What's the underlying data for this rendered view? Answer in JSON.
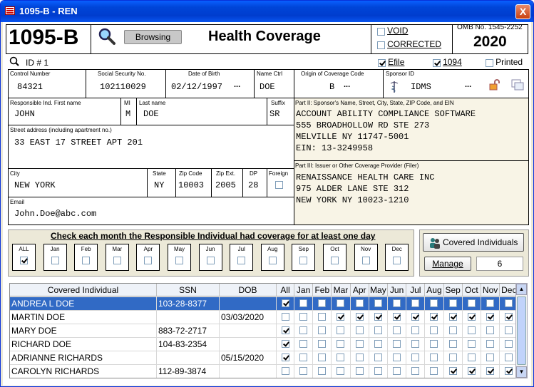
{
  "window": {
    "title": "1095-B - REN",
    "close_glyph": "X"
  },
  "header": {
    "form": "1095-B",
    "status_button": "Browsing",
    "title": "Health Coverage",
    "void_label": "VOID",
    "corrected_label": "CORRECTED",
    "void": false,
    "corrected": false,
    "omb": "OMB No. 1545-2252",
    "year": "2020"
  },
  "idrow": {
    "id_label": "ID # 1",
    "efile_label": "Efile",
    "efile": true,
    "f1094_label": "1094",
    "f1094": true,
    "printed_label": "Printed",
    "printed": false
  },
  "fields": {
    "control_number": {
      "label": "Control Number",
      "value": "84321"
    },
    "ssn": {
      "label": "Social Security No.",
      "value": "102110029"
    },
    "dob": {
      "label": "Date of Birth",
      "value": "02/12/1997"
    },
    "name_ctrl": {
      "label": "Name Ctrl",
      "value": "DOE"
    },
    "origin": {
      "label": "Origin of Coverage Code",
      "value": "B"
    },
    "sponsor": {
      "label": "Sponsor ID",
      "value": "IDMS"
    },
    "first_name": {
      "label": "Responsible Ind. First name",
      "value": "JOHN"
    },
    "mi": {
      "label": "MI",
      "value": "M"
    },
    "last_name": {
      "label": "Last name",
      "value": "DOE"
    },
    "suffix": {
      "label": "Suffix",
      "value": "SR"
    },
    "street": {
      "label": "Street address (including apartment no.)",
      "value": "33 EAST 17 STREET APT 201"
    },
    "city": {
      "label": "City",
      "value": "NEW YORK"
    },
    "state": {
      "label": "State",
      "value": "NY"
    },
    "zip": {
      "label": "Zip Code",
      "value": "10003"
    },
    "zipext": {
      "label": "Zip Ext.",
      "value": "2005"
    },
    "dp": {
      "label": "DP",
      "value": "28"
    },
    "foreign": {
      "label": "Foreign"
    },
    "email": {
      "label": "Email",
      "value": "John.Doe@abc.com"
    },
    "ellipsis": "..."
  },
  "part2": {
    "label": "Part II: Sponsor's Name, Street, City, State, ZIP Code, and EIN",
    "lines": [
      "ACCOUNT ABILITY COMPLIANCE SOFTWARE",
      "555 BROADHOLLOW RD STE 273",
      "MELVILLE NY 11747-5001",
      "EIN: 13-3249958"
    ]
  },
  "part3": {
    "label": "Part III: Issuer or Other Coverage Provider (Filer)",
    "lines": [
      "RENAISSANCE HEALTH CARE INC",
      "975 ALDER LANE STE 312",
      "NEW YORK NY 10023-1210"
    ]
  },
  "months_box": {
    "title": "Check each month the Responsible Individual had coverage for at least one day",
    "labels": [
      "ALL",
      "Jan",
      "Feb",
      "Mar",
      "Apr",
      "May",
      "Jun",
      "Jul",
      "Aug",
      "Sep",
      "Oct",
      "Nov",
      "Dec"
    ],
    "checked": [
      true,
      false,
      false,
      false,
      false,
      false,
      false,
      false,
      false,
      false,
      false,
      false,
      false
    ]
  },
  "covered": {
    "button": "Covered Individuals",
    "manage": "Manage",
    "count": "6"
  },
  "table": {
    "headers": [
      "Covered Individual",
      "SSN",
      "DOB",
      "All",
      "Jan",
      "Feb",
      "Mar",
      "Apr",
      "May",
      "Jun",
      "Jul",
      "Aug",
      "Sep",
      "Oct",
      "Nov",
      "Dec"
    ],
    "rows": [
      {
        "name": "ANDREA L DOE",
        "ssn": "103-28-8377",
        "dob": "",
        "checks": [
          true,
          false,
          false,
          false,
          false,
          false,
          false,
          false,
          false,
          false,
          false,
          false,
          false
        ],
        "selected": true
      },
      {
        "name": "MARTIN DOE",
        "ssn": "",
        "dob": "03/03/2020",
        "checks": [
          false,
          false,
          false,
          true,
          true,
          true,
          true,
          true,
          true,
          true,
          true,
          true,
          true
        ],
        "selected": false
      },
      {
        "name": "MARY DOE",
        "ssn": "883-72-2717",
        "dob": "",
        "checks": [
          true,
          false,
          false,
          false,
          false,
          false,
          false,
          false,
          false,
          false,
          false,
          false,
          false
        ],
        "selected": false
      },
      {
        "name": "RICHARD DOE",
        "ssn": "104-83-2354",
        "dob": "",
        "checks": [
          true,
          false,
          false,
          false,
          false,
          false,
          false,
          false,
          false,
          false,
          false,
          false,
          false
        ],
        "selected": false
      },
      {
        "name": "ADRIANNE RICHARDS",
        "ssn": "",
        "dob": "05/15/2020",
        "checks": [
          true,
          false,
          false,
          false,
          false,
          false,
          false,
          false,
          false,
          false,
          false,
          false,
          false
        ],
        "selected": false
      },
      {
        "name": "CAROLYN RICHARDS",
        "ssn": "112-89-3874",
        "dob": "",
        "checks": [
          false,
          false,
          false,
          false,
          false,
          false,
          false,
          false,
          false,
          true,
          true,
          true,
          true
        ],
        "selected": false
      }
    ]
  },
  "colors": {
    "titlebar": "#0045d8",
    "selection": "#316ac5",
    "panel": "#ece9d8",
    "cream": "#f8f4e6"
  }
}
